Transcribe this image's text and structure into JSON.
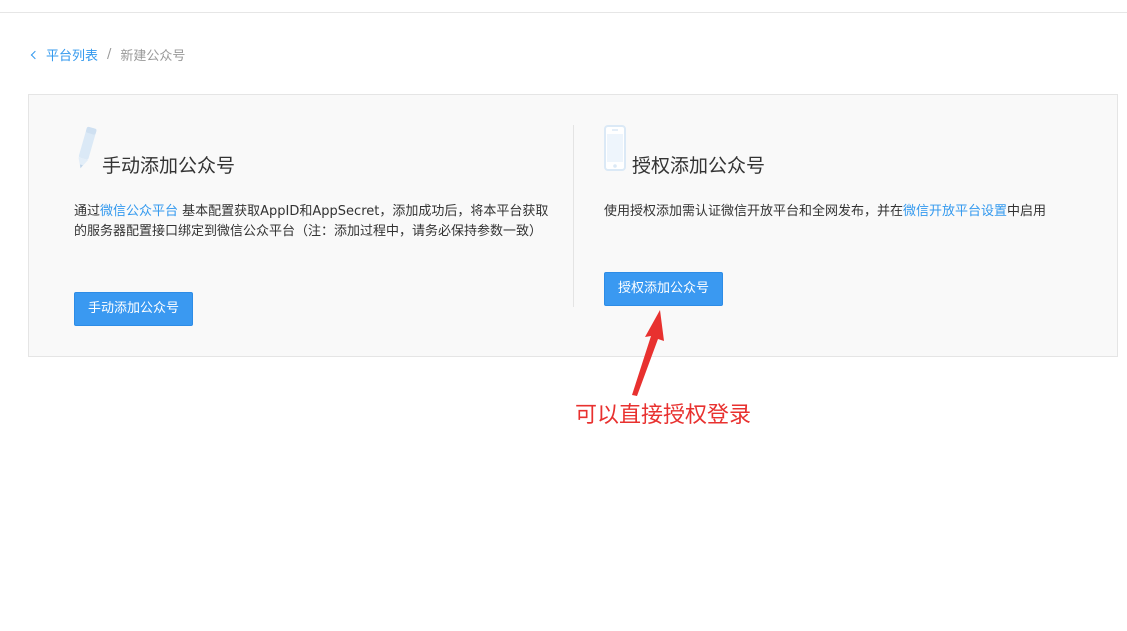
{
  "breadcrumb": {
    "parent_label": "平台列表",
    "separator": "/",
    "current_label": "新建公众号"
  },
  "manual_card": {
    "title": "手动添加公众号",
    "desc_prefix": "通过",
    "desc_link": "微信公众平台",
    "desc_suffix": " 基本配置获取AppID和AppSecret，添加成功后，将本平台获取的服务器配置接口绑定到微信公众平台（注：添加过程中，请务必保持参数一致）",
    "button_label": "手动添加公众号",
    "icon": "pencil-icon"
  },
  "auth_card": {
    "title": "授权添加公众号",
    "desc_prefix": "使用授权添加需认证微信开放平台和全网发布，并在",
    "desc_link": "微信开放平台设置",
    "desc_suffix": "中启用",
    "button_label": "授权添加公众号",
    "icon": "phone-icon"
  },
  "annotation": {
    "text": "可以直接授权登录",
    "color": "#e8312f"
  },
  "colors": {
    "accent": "#3399ee",
    "button": "#3a99f1",
    "panel_bg": "#f9f9f9"
  }
}
